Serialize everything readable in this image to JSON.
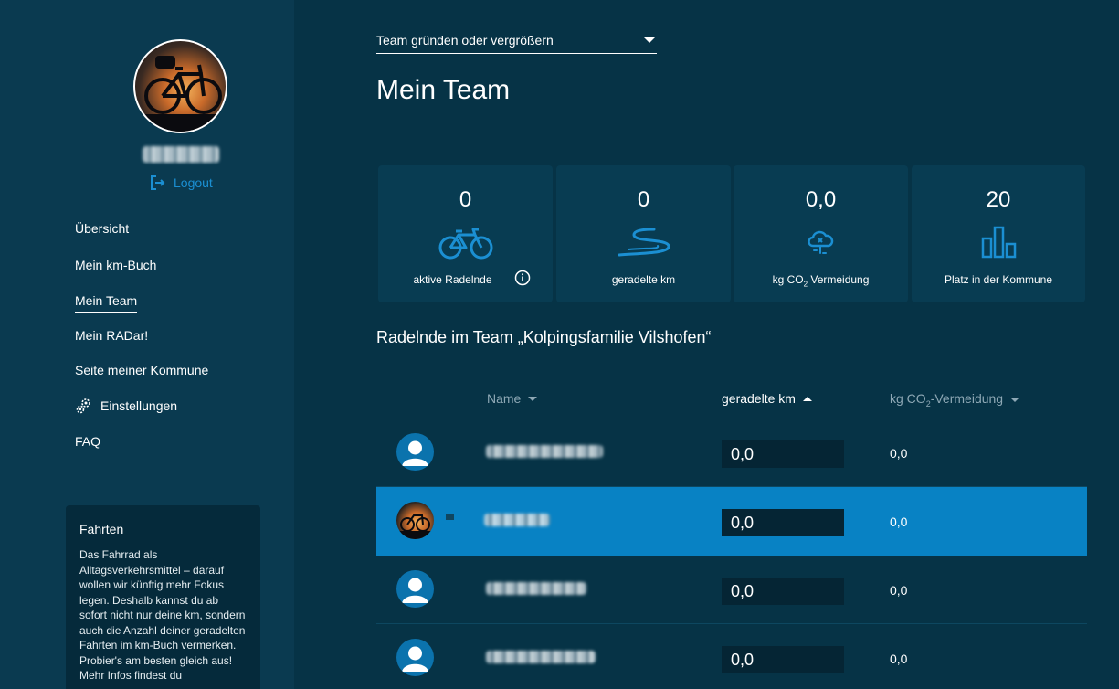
{
  "sidebar": {
    "logout_label": "Logout",
    "nav": [
      {
        "label": "Übersicht",
        "active": false
      },
      {
        "label": "Mein km-Buch",
        "active": false
      },
      {
        "label": "Mein Team",
        "active": true
      },
      {
        "label": "Mein RADar!",
        "active": false
      },
      {
        "label": "Seite meiner Kommune",
        "active": false
      },
      {
        "label": "Einstellungen",
        "active": false,
        "icon": "gears-icon"
      },
      {
        "label": "FAQ",
        "active": false
      }
    ],
    "info_box": {
      "title": "Fahrten",
      "text": "Das Fahrrad als Alltagsverkehrsmittel – darauf wollen wir künftig mehr Fokus legen. Deshalb kannst du ab sofort nicht nur deine km, sondern auch die Anzahl deiner geradelten Fahrten im km-Buch vermerken. Probier's am besten gleich aus! Mehr Infos findest du"
    }
  },
  "main": {
    "team_select": "Team gründen oder vergrößern",
    "title": "Mein Team",
    "stats": [
      {
        "value": "0",
        "label": "aktive Radelnde",
        "icon": "bicycle-icon"
      },
      {
        "value": "0",
        "label": "geradelte km",
        "icon": "road-icon"
      },
      {
        "value": "0,0",
        "label_pre": "kg CO",
        "label_sub": "2",
        "label_post": " Vermeidung",
        "icon": "cloud-icon"
      },
      {
        "value": "20",
        "label": "Platz in der Kommune",
        "icon": "ranking-icon"
      }
    ],
    "section_title": "Radelnde im Team „Kolpingsfamilie Vilshofen“",
    "table": {
      "col_name": "Name",
      "col_km": "geradelte km",
      "col_co2_pre": "kg CO",
      "col_co2_sub": "2",
      "col_co2_post": "-Vermeidung",
      "rows": [
        {
          "km": "0,0",
          "co2": "0,0"
        },
        {
          "km": "0,0",
          "co2": "0,0"
        },
        {
          "km": "0,0",
          "co2": "0,0"
        },
        {
          "km": "0,0",
          "co2": "0,0"
        }
      ]
    }
  },
  "colors": {
    "background": "#063346",
    "sidebar": "#0a3a50",
    "accent": "#1b8fd2",
    "highlight_row": "#0882c4"
  }
}
